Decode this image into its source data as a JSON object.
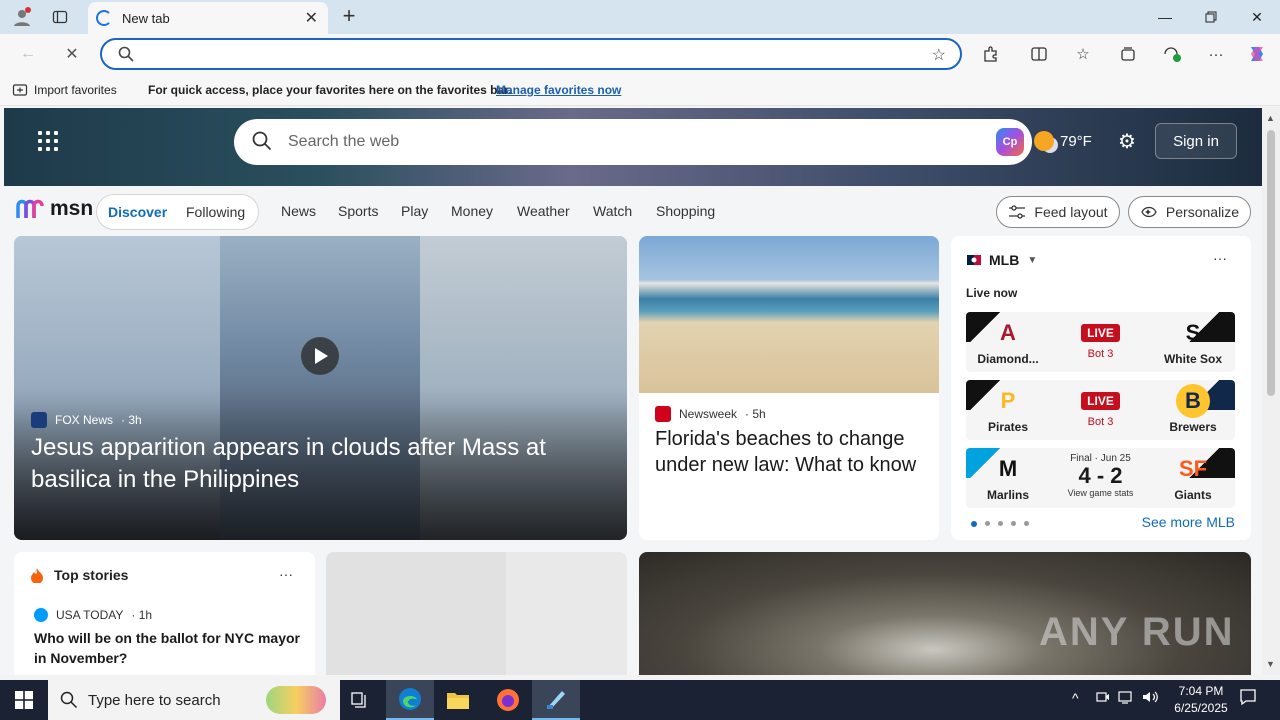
{
  "browser": {
    "tab_title": "New tab",
    "address_value": "",
    "favorites_bar": {
      "import_label": "Import favorites",
      "message": "For quick access, place your favorites here on the favorites bar.",
      "manage_link": "Manage favorites now"
    }
  },
  "msn": {
    "search_placeholder": "Search the web",
    "weather_temp": "79°F",
    "sign_in": "Sign in",
    "logo_text": "msn",
    "toggle": {
      "discover": "Discover",
      "following": "Following"
    },
    "nav": [
      "News",
      "Sports",
      "Play",
      "Money",
      "Weather",
      "Watch",
      "Shopping"
    ],
    "feed_layout": "Feed layout",
    "personalize": "Personalize"
  },
  "hero": {
    "source": "FOX News",
    "age": "· 3h",
    "title": "Jesus apparition appears in clouds after Mass at basilica in the Philippines"
  },
  "news_card": {
    "source": "Newsweek",
    "age": "· 5h",
    "title": "Florida's beaches to change under new law: What to know"
  },
  "mlb": {
    "title": "MLB",
    "live_now": "Live now",
    "games": [
      {
        "left": "Diamond...",
        "right": "White Sox",
        "status": "LIVE",
        "detail": "Bot 3"
      },
      {
        "left": "Pirates",
        "right": "Brewers",
        "status": "LIVE",
        "detail": "Bot 3"
      },
      {
        "left": "Marlins",
        "right": "Giants",
        "status": "Final · Jun 25",
        "score": "4 - 2",
        "detail": "View game stats"
      }
    ],
    "see_more": "See more MLB"
  },
  "top_stories": {
    "title": "Top stories",
    "source": "USA TODAY",
    "age": "· 1h",
    "headline": "Who will be on the ballot for NYC mayor in November?"
  },
  "watermark": "ANY RUN",
  "taskbar": {
    "search_placeholder": "Type here to search",
    "time": "7:04 PM",
    "date": "6/25/2025"
  }
}
